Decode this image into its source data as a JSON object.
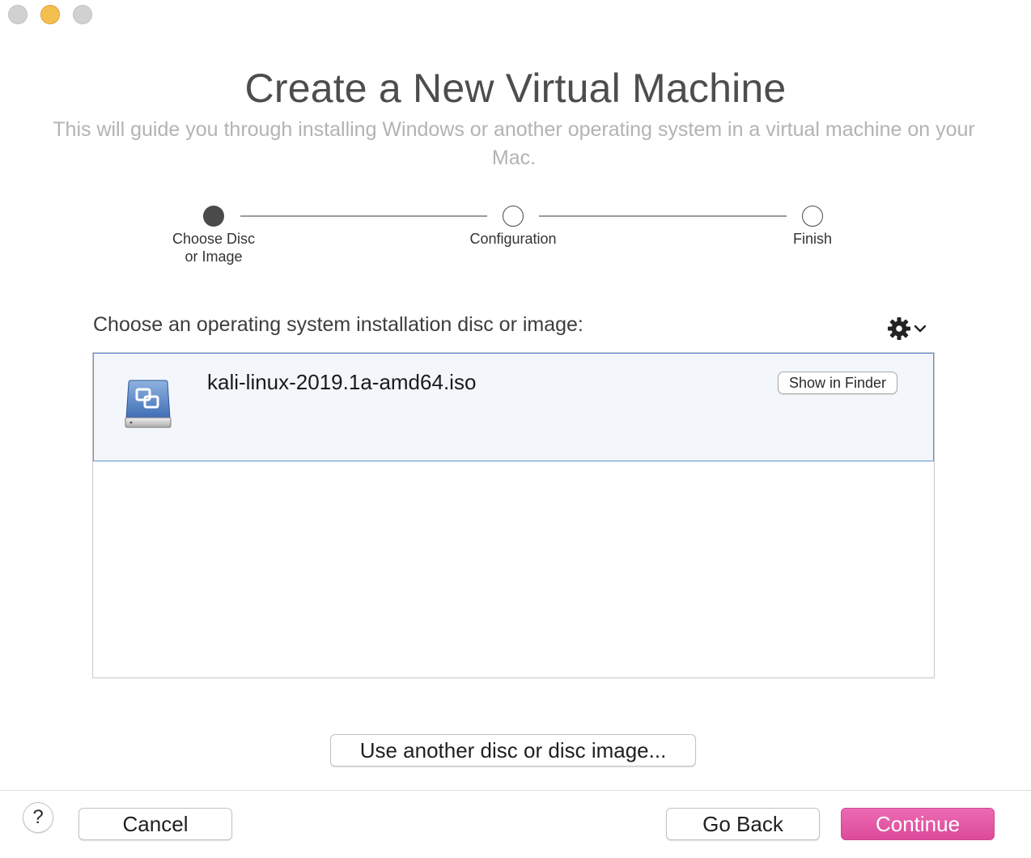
{
  "window": {
    "title": "Create a New Virtual Machine",
    "subtitle": "This will guide you through installing Windows or another operating system in a virtual machine on your Mac."
  },
  "stepper": {
    "steps": [
      {
        "label": "Choose Disc\nor Image",
        "state": "active"
      },
      {
        "label": "Configuration",
        "state": "inactive"
      },
      {
        "label": "Finish",
        "state": "inactive"
      }
    ]
  },
  "main": {
    "section_label": "Choose an operating system installation disc or image:",
    "gear_icon": "gear-icon",
    "items": [
      {
        "name": "kali-linux-2019.1a-amd64.iso",
        "icon": "disk-image-icon",
        "action_label": "Show in Finder",
        "selected": true
      }
    ],
    "other_disc_label": "Use another disc or disc image..."
  },
  "footer": {
    "help_label": "?",
    "cancel_label": "Cancel",
    "go_back_label": "Go Back",
    "continue_label": "Continue"
  },
  "colors": {
    "accent": "#e0519f",
    "selection_border": "#5e8fd6",
    "selection_bg": "#f3f6fb"
  }
}
